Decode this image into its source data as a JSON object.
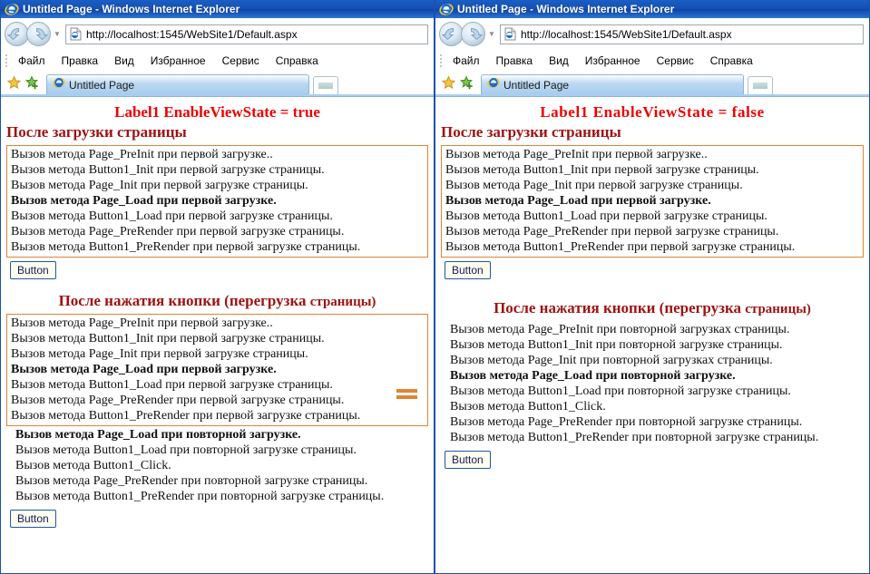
{
  "windows": [
    {
      "id": "left",
      "titlebar": {
        "text": "Untitled Page - Windows Internet Explorer",
        "icon": "ie-logo-icon"
      },
      "address": {
        "url": "http://localhost:1545/WebSite1/Default.aspx",
        "icon": "page-icon"
      },
      "nav": {
        "back": "◀",
        "forward": "▶",
        "dropdown": "▼"
      },
      "menu": [
        "Файл",
        "Правка",
        "Вид",
        "Избранное",
        "Сервис",
        "Справка"
      ],
      "tab": {
        "label": "Untitled Page"
      },
      "page": {
        "label_title": "Label1 EnableViewState = true",
        "section1_head": "После загрузки страницы",
        "section1_lines": [
          {
            "text": "Вызов метода Page_PreInit при первой загрузке..",
            "bold": false
          },
          {
            "text": "Вызов метода Button1_Init при первой загрузке страницы.",
            "bold": false
          },
          {
            "text": "Вызов метода Page_Init при первой загрузке страницы.",
            "bold": false
          },
          {
            "text": "Вызов метода Page_Load при первой загрузке.",
            "bold": true
          },
          {
            "text": "Вызов метода Button1_Load при первой загрузке страницы.",
            "bold": false
          },
          {
            "text": "Вызов метода Page_PreRender при первой загрузке страницы.",
            "bold": false
          },
          {
            "text": "Вызов метода Button1_PreRender при первой загрузке страницы.",
            "bold": false
          }
        ],
        "button1_label": "Button",
        "section2_head_main": "После нажатия кнопки (перегрузка",
        "section2_head_small": "страницы)",
        "section2_lines": [
          {
            "text": "Вызов метода Page_PreInit при первой загрузке..",
            "bold": false
          },
          {
            "text": "Вызов метода Button1_Init при первой загрузке страницы.",
            "bold": false
          },
          {
            "text": "Вызов метода Page_Init при первой загрузке страницы.",
            "bold": false
          },
          {
            "text": "Вызов метода Page_Load при первой загрузке.",
            "bold": true
          },
          {
            "text": "Вызов метода Button1_Load при первой загрузке страницы.",
            "bold": false
          },
          {
            "text": "Вызов метода Page_PreRender при первой загрузке страницы.",
            "bold": false
          },
          {
            "text": "Вызов метода Button1_PreRender при первой загрузке страницы.",
            "bold": false
          }
        ],
        "section2_extra_lines": [
          {
            "text": "Вызов метода Page_Load при повторной загрузке.",
            "bold": true
          },
          {
            "text": "Вызов метода Button1_Load при повторной загрузке страницы.",
            "bold": false
          },
          {
            "text": "Вызов метода Button1_Click.",
            "bold": false
          },
          {
            "text": "Вызов метода Page_PreRender при повторной загрузке страницы.",
            "bold": false
          },
          {
            "text": "Вызов метода Button1_PreRender при повторной загрузке страницы.",
            "bold": false
          }
        ],
        "button2_label": "Button",
        "equals_marker": "=",
        "accent_orange": "#e08434",
        "title_red": "#ee0000",
        "head_red": "#9e1212"
      }
    },
    {
      "id": "right",
      "titlebar": {
        "text": "Untitled Page - Windows Internet Explorer",
        "icon": "ie-logo-icon"
      },
      "address": {
        "url": "http://localhost:1545/WebSite1/Default.aspx",
        "icon": "page-icon"
      },
      "nav": {
        "back": "◀",
        "forward": "▶",
        "dropdown": "▼"
      },
      "menu": [
        "Файл",
        "Правка",
        "Вид",
        "Избранное",
        "Сервис",
        "Справка"
      ],
      "tab": {
        "label": "Untitled Page"
      },
      "page": {
        "label_title": "Label1  EnableViewState =  false",
        "section1_head": "После загрузки страницы",
        "section1_lines": [
          {
            "text": "Вызов метода Page_PreInit при первой загрузке..",
            "bold": false
          },
          {
            "text": "Вызов метода Button1_Init при первой загрузке страницы.",
            "bold": false
          },
          {
            "text": "Вызов метода Page_Init при первой загрузке страницы.",
            "bold": false
          },
          {
            "text": "Вызов метода Page_Load при первой загрузке.",
            "bold": true
          },
          {
            "text": "Вызов метода Button1_Load при первой загрузке страницы.",
            "bold": false
          },
          {
            "text": "Вызов метода Page_PreRender при первой загрузке страницы.",
            "bold": false
          },
          {
            "text": "Вызов метода Button1_PreRender при первой загрузке страницы.",
            "bold": false
          }
        ],
        "button1_label": "Button",
        "section2_head_main": "После нажатия кнопки (перегрузка",
        "section2_head_small": "страницы)",
        "section2_lines": [
          {
            "text": "Вызов метода Page_PreInit при повторной загрузках страницы.",
            "bold": false
          },
          {
            "text": "Вызов метода Button1_Init при повторной загрузке страницы.",
            "bold": false
          },
          {
            "text": "Вызов метода Page_Init при повторной загрузках страницы.",
            "bold": false
          },
          {
            "text": "Вызов метода Page_Load при повторной загрузке.",
            "bold": true
          },
          {
            "text": "Вызов метода Button1_Load при повторной загрузке страницы.",
            "bold": false
          },
          {
            "text": "Вызов метода Button1_Click.",
            "bold": false
          },
          {
            "text": "Вызов метода Page_PreRender при повторной загрузке страницы.",
            "bold": false
          },
          {
            "text": "Вызов метода Button1_PreRender при повторной загрузке страницы.",
            "bold": false
          }
        ],
        "section2_extra_lines": [],
        "button2_label": "Button",
        "accent_orange": "#e08434",
        "title_red": "#ee0000",
        "head_red": "#9e1212"
      }
    }
  ]
}
